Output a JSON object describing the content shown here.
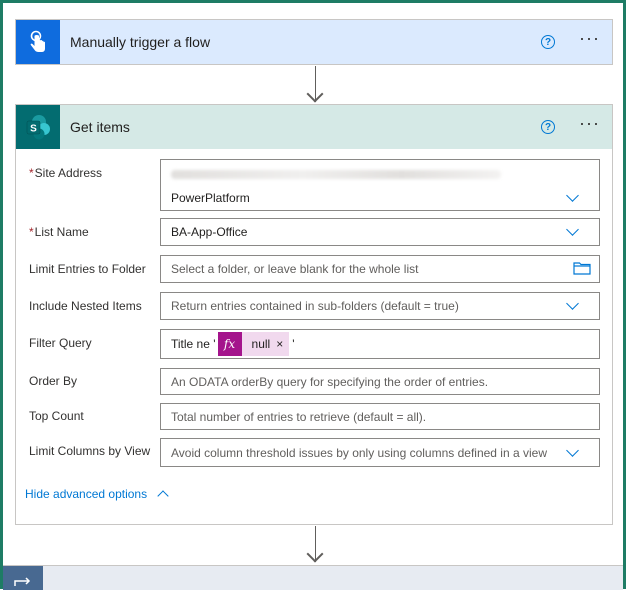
{
  "trigger_card": {
    "title": "Manually trigger a flow",
    "help_icon_glyph": "?",
    "more_glyph": "···",
    "header_color": "#dbeafe",
    "icon_color": "#0f6cde",
    "icon": "hand-touch-icon"
  },
  "get_items_card": {
    "title": "Get items",
    "help_icon_glyph": "?",
    "more_glyph": "···",
    "header_color": "#d5e9e6",
    "icon_color": "#036c70",
    "icon": "sharepoint-icon",
    "fields": {
      "site_address": {
        "label": "Site Address",
        "required": true,
        "value": "PowerPlatform"
      },
      "list_name": {
        "label": "List Name",
        "required": true,
        "value": "BA-App-Office"
      },
      "limit_entries_folder": {
        "label": "Limit Entries to Folder",
        "placeholder": "Select a folder, or leave blank for the whole list"
      },
      "include_nested": {
        "label": "Include Nested Items",
        "placeholder": "Return entries contained in sub-folders (default = true)"
      },
      "filter_query": {
        "label": "Filter Query",
        "prefix": "Title ne '",
        "token_label": "null",
        "token_fx": "fx",
        "token_remove": "×",
        "suffix": "'"
      },
      "order_by": {
        "label": "Order By",
        "placeholder": "An ODATA orderBy query for specifying the order of entries."
      },
      "top_count": {
        "label": "Top Count",
        "placeholder": "Total number of entries to retrieve (default = all)."
      },
      "limit_columns": {
        "label": "Limit Columns by View",
        "placeholder": "Avoid column threshold issues by only using columns defined in a view"
      }
    },
    "advanced_link": "Hide advanced options"
  },
  "next_card": {
    "header_color": "#e7ebf2",
    "icon_color": "#486991"
  },
  "accent": "#0078d4",
  "frame_border": "#1e7c65"
}
